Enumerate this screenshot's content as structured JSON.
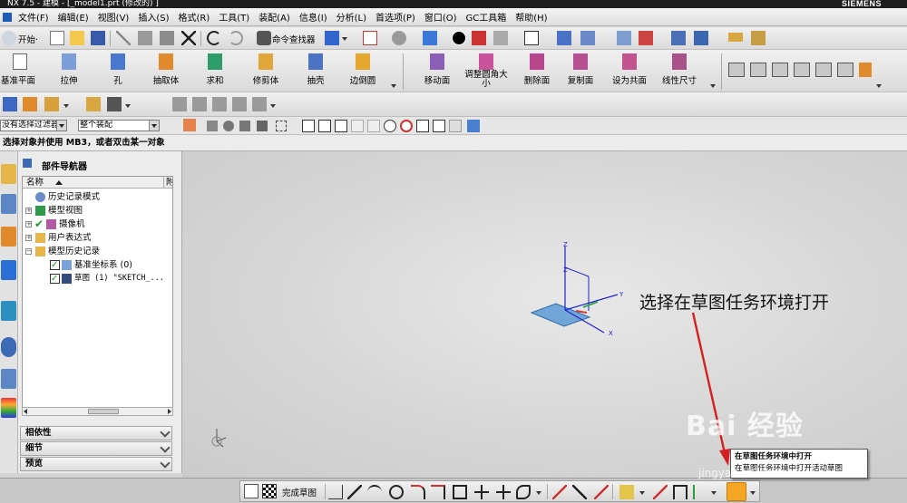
{
  "window": {
    "title": "NX 7.5 - 建模 - [_model1.prt (修改的) ]",
    "brand": "SIEMENS"
  },
  "menu": {
    "items": [
      "文件(F)",
      "编辑(E)",
      "视图(V)",
      "插入(S)",
      "格式(R)",
      "工具(T)",
      "装配(A)",
      "信息(I)",
      "分析(L)",
      "首选项(P)",
      "窗口(O)",
      "GC工具箱",
      "帮助(H)"
    ]
  },
  "standard_toolbar": {
    "start_label": "开始·",
    "command_finder_label": "命令查找器"
  },
  "feature_toolbar": {
    "buttons": [
      "基准平面",
      "拉伸",
      "孔",
      "抽取体",
      "求和",
      "修剪体",
      "抽壳",
      "边倒圆"
    ],
    "sync_buttons": [
      "移动面",
      "调整圆角大小",
      "删除面",
      "复制面",
      "设为共面",
      "线性尺寸"
    ]
  },
  "selection_bar": {
    "filter_value": "没有选择过滤器",
    "scope_value": "整个装配"
  },
  "cue_line": "选择对象并使用 MB3，或者双击某一对象",
  "part_navigator": {
    "title": "部件导航器",
    "column_name": "名称",
    "column_extra": "附",
    "rows": [
      {
        "label": "历史记录模式",
        "indent": 0
      },
      {
        "label": "模型视图",
        "indent": 0
      },
      {
        "label": "摄像机",
        "indent": 0
      },
      {
        "label": "用户表达式",
        "indent": 0
      },
      {
        "label": "模型历史记录",
        "indent": 0
      },
      {
        "label": "基准坐标系 (0)",
        "indent": 1
      },
      {
        "label": "草图 (1) \"SKETCH_...",
        "indent": 1
      }
    ],
    "panels": [
      "相依性",
      "细节",
      "预览"
    ]
  },
  "viewport": {
    "annotation": "选择在草图任务环境打开",
    "triad_labels": {
      "z1": "Z",
      "z2": "Z",
      "y": "Y",
      "x": "X"
    }
  },
  "sketch_toolbar": {
    "finish_label": "完成草图"
  },
  "tooltip": {
    "title": "在草图任务环境中打开",
    "body": "在草图任务环境中打开活动草图"
  },
  "watermark": {
    "main": "Bai 经验",
    "sub": "jingyan.baidu.com"
  },
  "colors": {
    "accent": "#1c5cb8",
    "plane_fill": "#5b9bd5",
    "axis_blue": "#2222cc",
    "annotation_arrow": "#d32020",
    "selection_orange": "#f5a623"
  }
}
